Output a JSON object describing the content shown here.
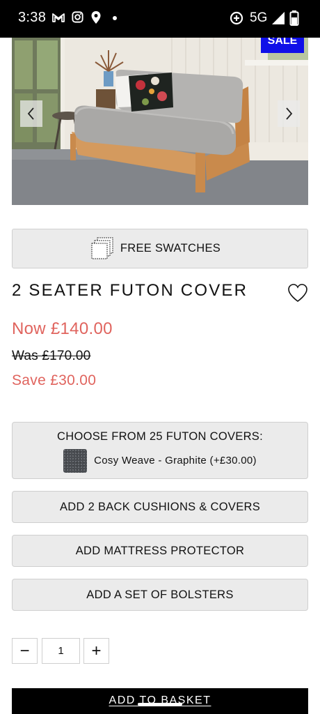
{
  "status_bar": {
    "time": "3:38",
    "network": "5G",
    "icons": [
      "gmail-icon",
      "instagram-icon",
      "location-icon",
      "dot-icon",
      "data-saver-icon",
      "signal-icon",
      "battery-icon"
    ]
  },
  "hero": {
    "sale_badge": "SALE",
    "prev_arrow": "‹",
    "next_arrow": "›"
  },
  "swatches": {
    "label": "FREE SWATCHES"
  },
  "product": {
    "title": "2 SEATER FUTON COVER",
    "price_now": "Now  £140.00",
    "price_was": "Was  £170.00",
    "price_save": "Save  £30.00"
  },
  "options": {
    "covers_title": "CHOOSE FROM 25 FUTON COVERS:",
    "selected_cover": "Cosy Weave - Graphite (+£30.00)",
    "cushions": "ADD 2 BACK CUSHIONS & COVERS",
    "protector": "ADD MATTRESS PROTECTOR",
    "bolsters": "ADD A SET OF BOLSTERS"
  },
  "quantity": {
    "minus": "−",
    "value": "1",
    "plus": "+"
  },
  "basket": {
    "label": "ADD TO BASKET"
  },
  "colors": {
    "accent_red": "#e0645e",
    "sale_blue": "#1010e8",
    "button_grey": "#ebebeb",
    "basket_black": "#000000"
  }
}
